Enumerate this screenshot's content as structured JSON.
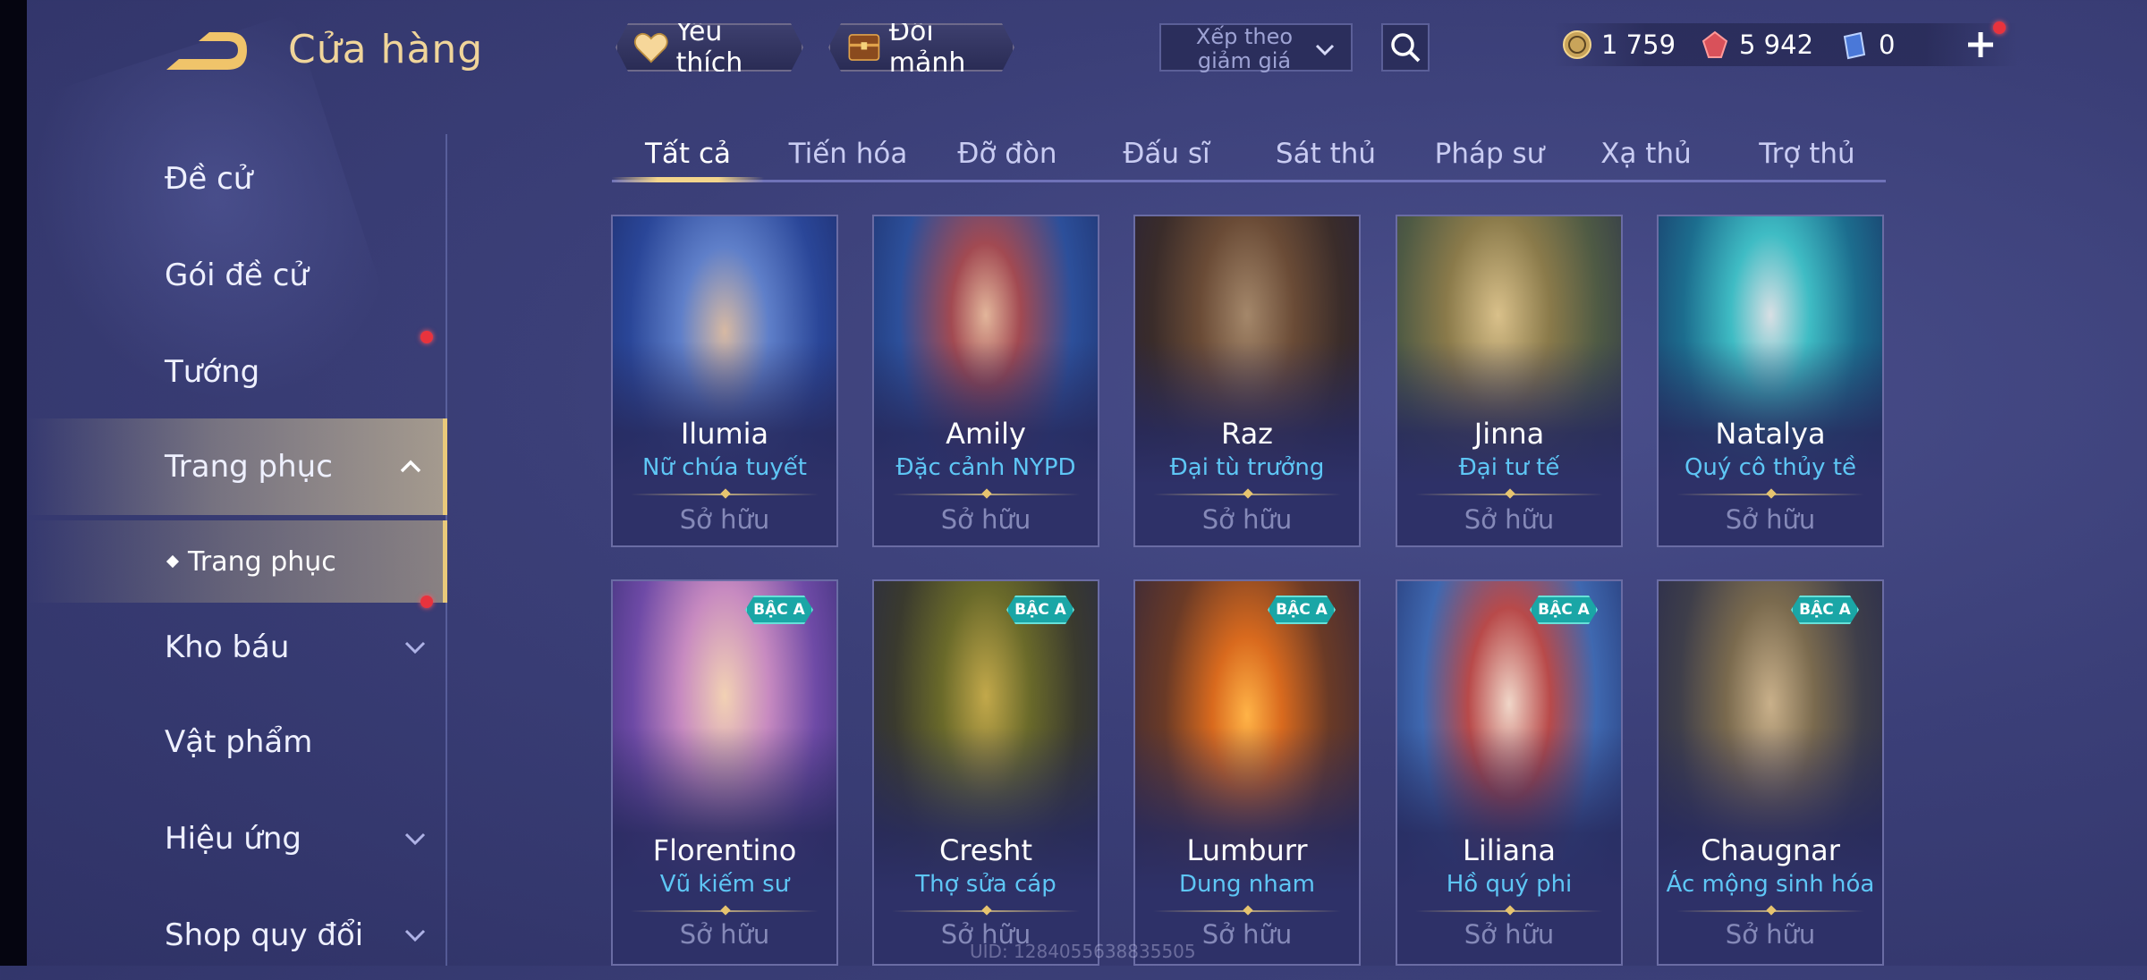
{
  "header": {
    "title": "Cửa hàng",
    "favorite_label": "Yêu thích",
    "exchange_label": "Đổi mảnh",
    "sort_label": "Xếp theo giảm giá",
    "currency": {
      "coins": "1 759",
      "gems": "5 942",
      "vouchers": "0"
    }
  },
  "sidebar": {
    "items": [
      {
        "label": "Đề cử"
      },
      {
        "label": "Gói đề cử"
      },
      {
        "label": "Tướng"
      },
      {
        "label": "Trang phục"
      },
      {
        "label": "Kho báu"
      },
      {
        "label": "Vật phẩm"
      },
      {
        "label": "Hiệu ứng"
      },
      {
        "label": "Shop quy đổi"
      }
    ],
    "sub_item": "Trang phục"
  },
  "tabs": [
    {
      "label": "Tất cả"
    },
    {
      "label": "Tiến hóa"
    },
    {
      "label": "Đỡ đòn"
    },
    {
      "label": "Đấu sĩ"
    },
    {
      "label": "Sát thủ"
    },
    {
      "label": "Pháp sư"
    },
    {
      "label": "Xạ thủ"
    },
    {
      "label": "Trợ thủ"
    }
  ],
  "cards": [
    {
      "name": "Ilumia",
      "skin": "Nữ chúa tuyết",
      "status": "Sở hữu"
    },
    {
      "name": "Amily",
      "skin": "Đặc cảnh NYPD",
      "status": "Sở hữu"
    },
    {
      "name": "Raz",
      "skin": "Đại tù trưởng",
      "status": "Sở hữu"
    },
    {
      "name": "Jinna",
      "skin": "Đại tư tế",
      "status": "Sở hữu"
    },
    {
      "name": "Natalya",
      "skin": "Quý cô thủy tề",
      "status": "Sở hữu"
    },
    {
      "name": "Florentino",
      "skin": "Vũ kiếm sư",
      "status": "Sở hữu",
      "badge": "BẬC A"
    },
    {
      "name": "Cresht",
      "skin": "Thợ sửa cáp",
      "status": "Sở hữu",
      "badge": "BẬC A"
    },
    {
      "name": "Lumburr",
      "skin": "Dung nham",
      "status": "Sở hữu",
      "badge": "BẬC A"
    },
    {
      "name": "Liliana",
      "skin": "Hồ quý phi",
      "status": "Sở hữu",
      "badge": "BẬC A"
    },
    {
      "name": "Chaugnar",
      "skin": "Ác mộng sinh hóa",
      "status": "Sở hữu",
      "badge": "BẬC A"
    }
  ],
  "uid": "UID: 1284055638835505",
  "colors": {
    "accent_gold": "#f0d59a",
    "skin_name_blue": "#5ec6f5",
    "badge_teal": "#1aa6a6",
    "notification_red": "#e8333d"
  }
}
